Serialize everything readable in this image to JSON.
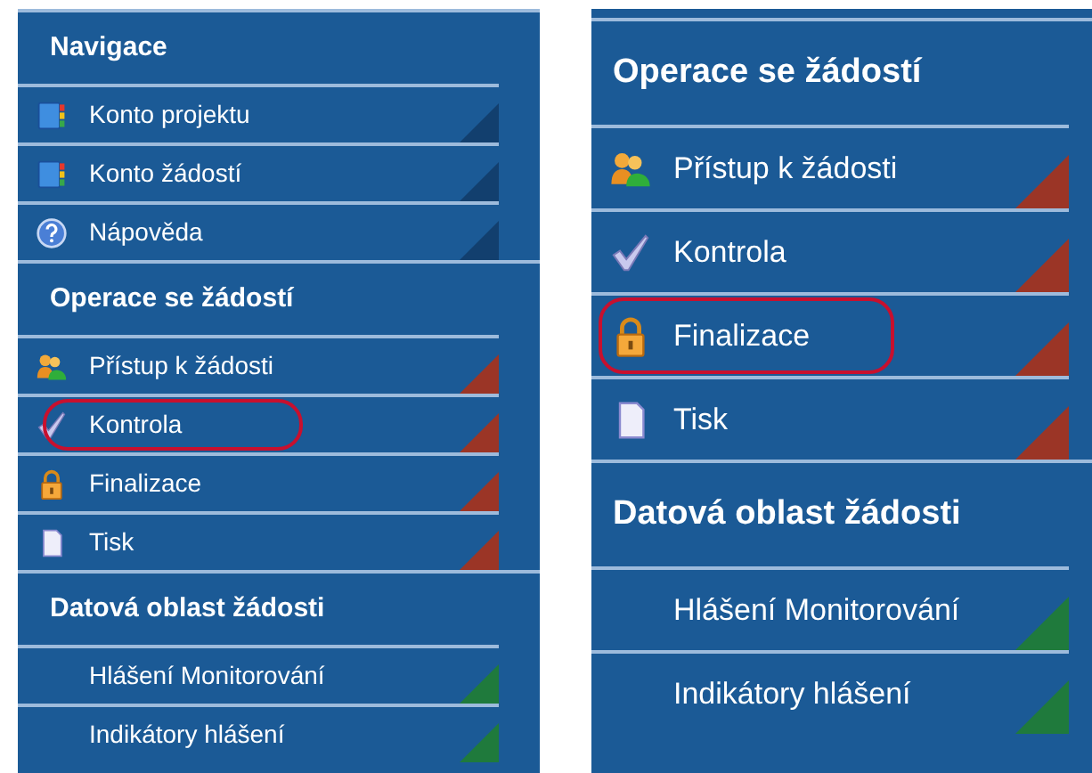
{
  "panels": [
    {
      "sections": [
        {
          "title": "Navigace",
          "color": "#123f6e",
          "items": [
            {
              "kind": "book",
              "label": "Konto projektu",
              "highlighted": false
            },
            {
              "kind": "book",
              "label": "Konto žádostí",
              "highlighted": false
            },
            {
              "kind": "help",
              "label": "Nápověda",
              "highlighted": false
            }
          ]
        },
        {
          "title": "Operace se žádostí",
          "color": "#9b3526",
          "items": [
            {
              "kind": "users",
              "label": "Přístup k žádosti",
              "highlighted": false
            },
            {
              "kind": "check",
              "label": "Kontrola",
              "highlighted": true
            },
            {
              "kind": "lock",
              "label": "Finalizace",
              "highlighted": false
            },
            {
              "kind": "page",
              "label": "Tisk",
              "highlighted": false
            }
          ]
        },
        {
          "title": "Datová oblast žádosti",
          "color": "#1f7a3c",
          "items": [
            {
              "kind": "none",
              "label": "Hlášení Monitorování",
              "highlighted": false
            },
            {
              "kind": "none",
              "label": "Indikátory hlášení",
              "highlighted": false
            }
          ]
        }
      ]
    },
    {
      "sections": [
        {
          "title": "Operace se žádostí",
          "color": "#9b3526",
          "items": [
            {
              "kind": "users",
              "label": "Přístup k žádosti",
              "highlighted": false
            },
            {
              "kind": "check",
              "label": "Kontrola",
              "highlighted": false
            },
            {
              "kind": "lock",
              "label": "Finalizace",
              "highlighted": true
            },
            {
              "kind": "page",
              "label": "Tisk",
              "highlighted": false
            }
          ]
        },
        {
          "title": "Datová oblast žádosti",
          "color": "#1f7a3c",
          "items": [
            {
              "kind": "none",
              "label": "Hlášení Monitorování",
              "highlighted": false
            },
            {
              "kind": "none",
              "label": "Indikátory hlášení",
              "highlighted": false
            }
          ]
        }
      ]
    }
  ]
}
